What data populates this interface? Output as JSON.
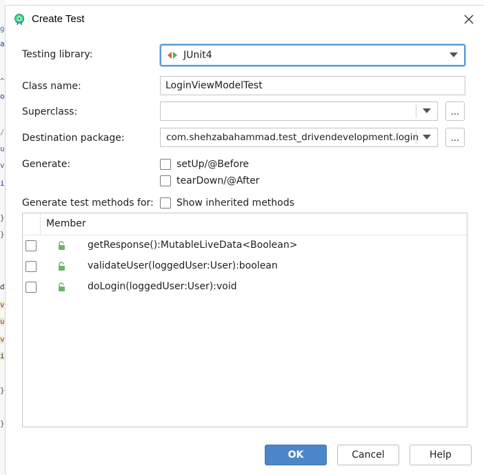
{
  "dialog": {
    "title": "Create Test",
    "icon": "android-studio-icon",
    "close_icon": "close-icon"
  },
  "form": {
    "testing_library": {
      "label": "Testing library:",
      "value": "JUnit4",
      "icon": "junit-icon"
    },
    "class_name": {
      "label": "Class name:",
      "value": "LoginViewModelTest"
    },
    "superclass": {
      "label": "Superclass:",
      "value": "",
      "browse_label": "..."
    },
    "destination_package": {
      "label": "Destination package:",
      "value": "com.shehzabahammad.test_drivendevelopment.login",
      "browse_label": "..."
    },
    "generate": {
      "label": "Generate:",
      "options": [
        {
          "label": "setUp/@Before",
          "checked": false
        },
        {
          "label": "tearDown/@After",
          "checked": false
        }
      ]
    },
    "methods_for": {
      "label": "Generate test methods for:",
      "show_inherited_label": "Show inherited methods",
      "show_inherited_checked": false
    }
  },
  "table": {
    "column_header": "Member",
    "rows": [
      {
        "method": "getResponse():MutableLiveData<Boolean>",
        "checked": false,
        "icon": "public-method-lock-icon"
      },
      {
        "method": "validateUser(loggedUser:User):boolean",
        "checked": false,
        "icon": "public-method-lock-icon"
      },
      {
        "method": "doLogin(loggedUser:User):void",
        "checked": false,
        "icon": "public-method-lock-icon"
      }
    ]
  },
  "buttons": {
    "ok": "OK",
    "cancel": "Cancel",
    "help": "Help"
  },
  "colors": {
    "accent": "#4a86c8",
    "focus_border": "#5b9bd5",
    "lock_green": "#6fb36a"
  }
}
